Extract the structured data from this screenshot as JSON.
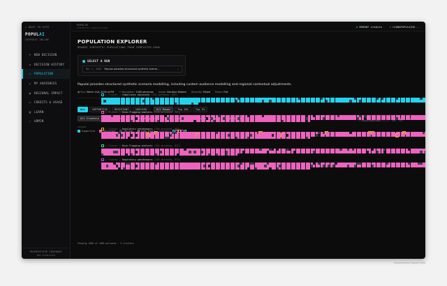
{
  "sidebar": {
    "back": "← BACK TO SITE",
    "logo_main": "POPUL",
    "logo_accent": "AI",
    "logo_sub": "CORPORAT ONLINE",
    "items": [
      {
        "label": "NEW DECISION",
        "icon": "plus-icon"
      },
      {
        "label": "DECISION HISTORY",
        "icon": "history-icon"
      },
      {
        "label": "POPULATION",
        "icon": "people-icon"
      },
      {
        "label": "MY AUDIENCES",
        "icon": "audience-icon"
      },
      {
        "label": "REGIONAL IMPACT",
        "icon": "globe-icon"
      },
      {
        "label": "CREDITS & USAGE",
        "icon": "card-icon"
      },
      {
        "label": "LEARN",
        "icon": "book-icon"
      },
      {
        "label": "ADMIN",
        "icon": "admin-icon"
      }
    ],
    "active_index": 2,
    "coverage_title": "PERSPECTIVE COVERAGE",
    "coverage_sub": "Not predictive"
  },
  "topbar": {
    "crumb1": "POPULUS",
    "crumb2": "SYNTHETIC POPULATIONS",
    "credits": "999987 credits",
    "user": "LEONAPOPULAIHO..."
  },
  "main": {
    "title": "POPULATION EXPLORER",
    "subtitle": "BROWSE SYNTHETIC POPULATIONS FROM COMPLETED RUNS",
    "run_header": "SELECT A RUN",
    "run_date": "Mar 2, 2026",
    "run_name": "Populai provides structured synthetic scenar...",
    "description": "Populai provides structured synthetic scenario modelling, including custom audience modelling and regional contextual adjustments.",
    "meta": {
      "run_label": "Run:",
      "run_value": "March 2nd, 2026 at",
      "time": "PM",
      "population_label": "Population:",
      "population_value": "1000 personas",
      "scope_label": "Scope:",
      "scope_value": "Decision Makers",
      "diversity_label": "Diversity:",
      "diversity_value": "Mixed",
      "power_label": "Power:",
      "power_value": "Flat"
    },
    "stance_filters": [
      "ALL",
      "SUPPORTIVE",
      "RESISTANT",
      "UNCLEAR"
    ],
    "power_filters": [
      "All Power",
      "Top 10%",
      "Top 5%"
    ],
    "cluster_filters": [
      "All Clusters",
      "Compliance a...",
      "Risk-flaggin...",
      "Risk-flaggin...",
      "Regulatory g...",
      "Regulatory g..."
    ],
    "search_placeholder": "Search role/function",
    "zoom": "100%",
    "legend_title": "LEGEND",
    "legend": {
      "supportive": "Supportive",
      "resistant": "Resistant",
      "unclear": "Unclear",
      "high_power": "High Power",
      "clusters": "Clusters:"
    },
    "colors": {
      "supportive": "#22d3ee",
      "resistant": "#f062c0",
      "unclear": "#3f3f46",
      "cluster_palette": [
        "#22d3ee",
        "#f062c0",
        "#eab308",
        "#a855f7",
        "#4ade80"
      ]
    },
    "clusters": [
      {
        "tag": "[ Cluster ]",
        "name": "Compliance advocates",
        "info": "(314 personas, 82%)",
        "box_color": "#22d3ee",
        "count": 314,
        "main": "#22d3ee"
      },
      {
        "tag": "[ Cluster ]",
        "name": "Risk-flagging analysts",
        "info": "(196 personas, 96%)",
        "box_color": "#f062c0",
        "count": 360,
        "main": "#f062c0"
      },
      {
        "tag": "[ Cluster ]",
        "name": "Regulatory gatekeepers",
        "info": "(190 personas, 94%)",
        "box_color": "#eab308",
        "count": 360,
        "main": "#f062c0"
      },
      {
        "tag": "[ Cluster ]",
        "name": "Risk-flagging analysts",
        "info": "(154 personas, 97%)",
        "box_color": "#4ade80",
        "count": 330,
        "main": "#f062c0"
      },
      {
        "tag": "[ Cluster ]",
        "name": "Regulatory gatekeepers",
        "info": "(146 personas, 97%)",
        "box_color": "#a855f7",
        "count": 360,
        "main": "#f062c0"
      }
    ],
    "showing": "Showing 1000 of 1000 personas · 5 clusters"
  },
  "footer": "Generated by Populai AMS"
}
